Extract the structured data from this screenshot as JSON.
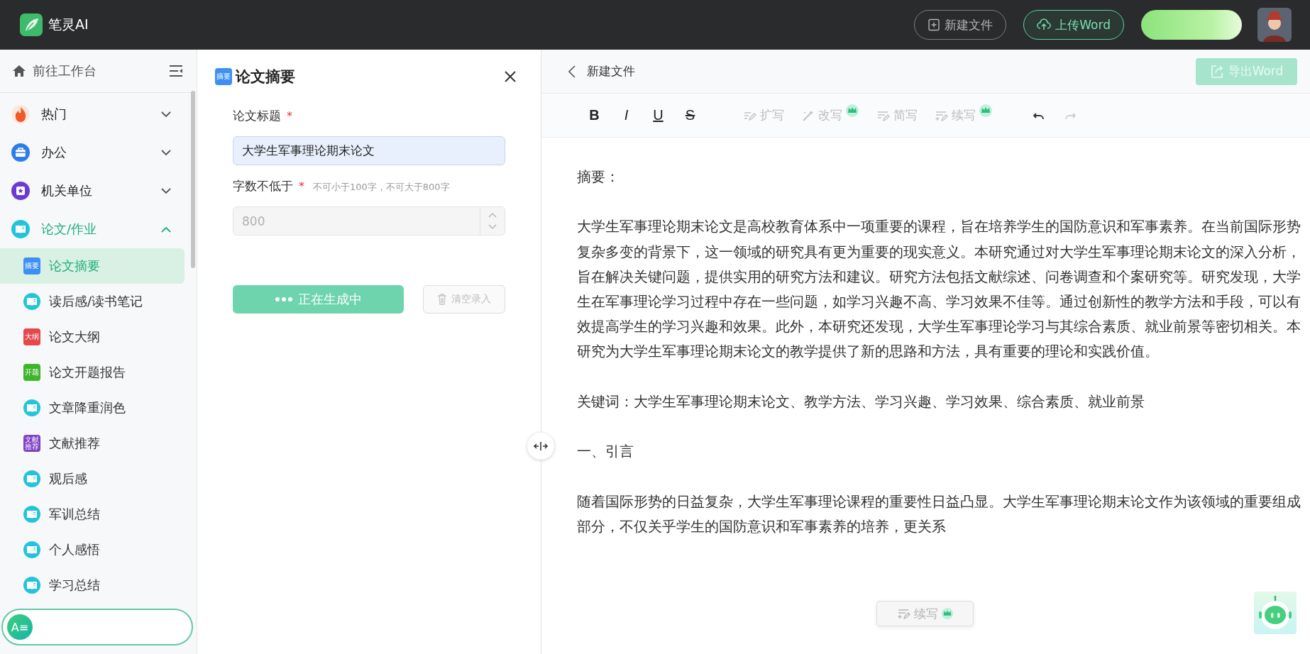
{
  "app": {
    "name": "笔灵AI"
  },
  "header_buttons": [
    {
      "kind": "new_file",
      "label": "新建文件"
    },
    {
      "kind": "upload",
      "label": "上传Word"
    },
    {
      "kind": "promo"
    }
  ],
  "sidebar": {
    "workbench_link": "前往工作台",
    "groups": [
      {
        "kind": "hot",
        "label": "热门",
        "expanded": false
      },
      {
        "kind": "office",
        "label": "办公",
        "expanded": false
      },
      {
        "kind": "agency",
        "label": "机关单位",
        "expanded": false
      },
      {
        "kind": "paper",
        "label": "论文/作业",
        "expanded": true,
        "children": [
          {
            "kind": "badge",
            "badge": "摘要",
            "color": "#3d8ff5",
            "label": "论文摘要",
            "selected": true
          },
          {
            "kind": "book",
            "label": "读后感/读书笔记",
            "selected": false
          },
          {
            "kind": "badge",
            "badge": "大纲",
            "color": "#e5484d",
            "label": "论文大纲",
            "selected": false
          },
          {
            "kind": "badge",
            "badge": "开题",
            "color": "#3fb52c",
            "label": "论文开题报告",
            "selected": false
          },
          {
            "kind": "book",
            "label": "文章降重润色",
            "selected": false
          },
          {
            "kind": "badge",
            "badge": "文献推荐",
            "color": "#7e3fc4",
            "label": "文献推荐",
            "selected": false
          },
          {
            "kind": "book",
            "label": "观后感",
            "selected": false
          },
          {
            "kind": "book",
            "label": "军训总结",
            "selected": false
          },
          {
            "kind": "book",
            "label": "个人感悟",
            "selected": false
          },
          {
            "kind": "book",
            "label": "学习总结",
            "selected": false
          }
        ]
      }
    ],
    "assistant_pill": {
      "label": "A≡"
    }
  },
  "panel": {
    "badge": "摘要",
    "title": "论文摘要",
    "fields": [
      {
        "kind": "text",
        "label": "论文标题",
        "mark": "*",
        "value": "大学生军事理论期末论文",
        "disabled": false
      },
      {
        "kind": "number",
        "label": "字数不低于",
        "mark": "*",
        "hint": "不可小于100字，不可大于800字",
        "value": "800",
        "disabled": true
      }
    ],
    "generate_button": {
      "label": "正在生成中",
      "loading": true
    },
    "clear_button": {
      "label": "清空录入",
      "disabled": true
    }
  },
  "editor": {
    "title": "新建文件",
    "export_button": {
      "label": "导出Word",
      "disabled": true
    },
    "format_tools": [
      {
        "kind": "bold",
        "label": "B"
      },
      {
        "kind": "italic",
        "label": "I"
      },
      {
        "kind": "underline",
        "label": "U"
      },
      {
        "kind": "strike",
        "label": "S"
      }
    ],
    "ai_tools": [
      {
        "kind": "expand",
        "label": "扩写",
        "vip": false,
        "disabled": true
      },
      {
        "kind": "rewrite",
        "label": "改写",
        "vip": true,
        "disabled": true
      },
      {
        "kind": "shorten",
        "label": "简写",
        "vip": false,
        "disabled": true
      },
      {
        "kind": "continue",
        "label": "续写",
        "vip": true,
        "disabled": true
      }
    ],
    "history": [
      {
        "kind": "undo",
        "disabled": false
      },
      {
        "kind": "redo",
        "disabled": true
      }
    ],
    "content": [
      "摘要：",
      "大学生军事理论期末论文是高校教育体系中一项重要的课程，旨在培养学生的国防意识和军事素养。在当前国际形势复杂多变的背景下，这一领域的研究具有更为重要的现实意义。本研究通过对大学生军事理论期末论文的深入分析，旨在解决关键问题，提供实用的研究方法和建议。研究方法包括文献综述、问卷调查和个案研究等。研究发现，大学生在军事理论学习过程中存在一些问题，如学习兴趣不高、学习效果不佳等。通过创新性的教学方法和手段，可以有效提高学生的学习兴趣和效果。此外，本研究还发现，大学生军事理论学习与其综合素质、就业前景等密切相关。本研究为大学生军事理论期末论文的教学提供了新的思路和方法，具有重要的理论和实践价值。",
      "关键词：大学生军事理论期末论文、教学方法、学习兴趣、学习效果、综合素质、就业前景",
      "一、引言",
      "随着国际形势的日益复杂，大学生军事理论课程的重要性日益凸显。大学生军事理论期末论文作为该领域的重要组成部分，不仅关乎学生的国防意识和军事素养的培养，更关系"
    ],
    "continue_button": {
      "label": "续写",
      "vip": true,
      "disabled": true
    }
  }
}
